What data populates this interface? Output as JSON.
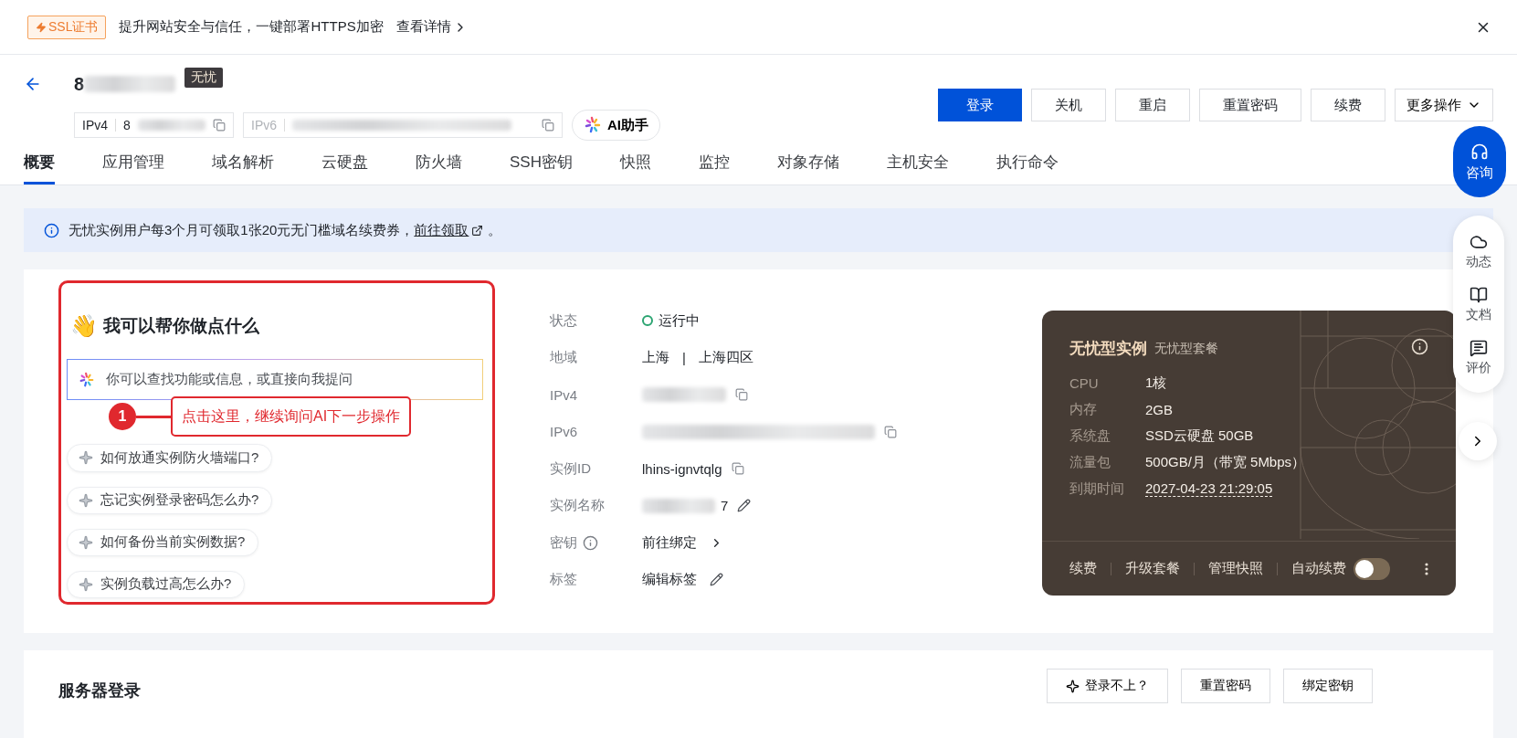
{
  "banner": {
    "tag": "SSL证书",
    "text": "提升网站安全与信任，一键部署HTTPS加密",
    "link": "查看详情"
  },
  "header": {
    "title_start": "8",
    "badge": "无忧",
    "ip_fields": [
      {
        "label": "IPv4",
        "visible": "8"
      },
      {
        "label": "IPv6"
      }
    ],
    "ai_button": "AI助手",
    "actions": [
      {
        "label": "登录",
        "primary": true
      },
      {
        "label": "关机",
        "primary": false
      },
      {
        "label": "重启",
        "primary": false
      },
      {
        "label": "重置密码",
        "primary": false
      },
      {
        "label": "续费",
        "primary": false
      }
    ],
    "more": "更多操作"
  },
  "tabs": [
    {
      "label": "概要",
      "selected": true
    },
    {
      "label": "应用管理",
      "selected": false
    },
    {
      "label": "域名解析",
      "selected": false
    },
    {
      "label": "云硬盘",
      "selected": false
    },
    {
      "label": "防火墙",
      "selected": false
    },
    {
      "label": "SSH密钥",
      "selected": false
    },
    {
      "label": "快照",
      "selected": false
    },
    {
      "label": "监控",
      "selected": false
    },
    {
      "label": "对象存储",
      "selected": false
    },
    {
      "label": "主机安全",
      "selected": false
    },
    {
      "label": "执行命令",
      "selected": false
    }
  ],
  "notice": {
    "text": "无忧实例用户每3个月可领取1张20元无门槛域名续费券，",
    "link": "前往领取",
    "end": "。"
  },
  "assistant": {
    "icon": "👋",
    "title": "我可以帮你做点什么",
    "placeholder": "你可以查找功能或信息，或直接向我提问",
    "suggestions": [
      "如何放通实例防火墙端口?",
      "忘记实例登录密码怎么办?",
      "如何备份当前实例数据?",
      "实例负载过高怎么办?"
    ],
    "annotation": {
      "number": "1",
      "text": "点击这里，继续询问AI下一步操作"
    }
  },
  "details": [
    {
      "label": "状态",
      "kind": "status",
      "value": "运行中",
      "color": "#2ba471"
    },
    {
      "label": "地域",
      "kind": "region",
      "value": "上海",
      "separator": "|",
      "value_2": "上海四区"
    },
    {
      "label": "IPv4",
      "kind": "redacted_copy"
    },
    {
      "label": "IPv6",
      "kind": "redacted_copy_long"
    },
    {
      "label": "实例ID",
      "kind": "copy",
      "value": "lhins-ignvtqlg"
    },
    {
      "label": "实例名称",
      "kind": "redacted_edit",
      "value": "7"
    },
    {
      "label": "密钥",
      "kind": "link",
      "value": "前往绑定"
    },
    {
      "label": "标签",
      "kind": "edit",
      "value": "编辑标签"
    }
  ],
  "plan_card": {
    "title": "无忧型实例",
    "subtitle": "无忧型套餐",
    "specs": [
      {
        "label": "CPU",
        "value": "1核"
      },
      {
        "label": "内存",
        "value": "2GB"
      },
      {
        "label": "系统盘",
        "value": "SSD云硬盘 50GB"
      },
      {
        "label": "流量包",
        "value": "500GB/月（带宽 5Mbps）"
      }
    ],
    "expiry": {
      "label": "到期时间",
      "value": "2027-04-23 21:29:05"
    },
    "actions": [
      "续费",
      "升级套餐",
      "管理快照"
    ],
    "auto_renew": {
      "label": "自动续费",
      "on": false
    }
  },
  "float_menu": {
    "consult": "咨询",
    "items": [
      {
        "label": "动态",
        "kind": "cloud"
      },
      {
        "label": "文档",
        "kind": "book"
      },
      {
        "label": "评价",
        "kind": "comment"
      }
    ]
  },
  "login_section": {
    "title": "服务器登录",
    "buttons": [
      "登录不上？",
      "重置密码",
      "绑定密钥"
    ]
  }
}
